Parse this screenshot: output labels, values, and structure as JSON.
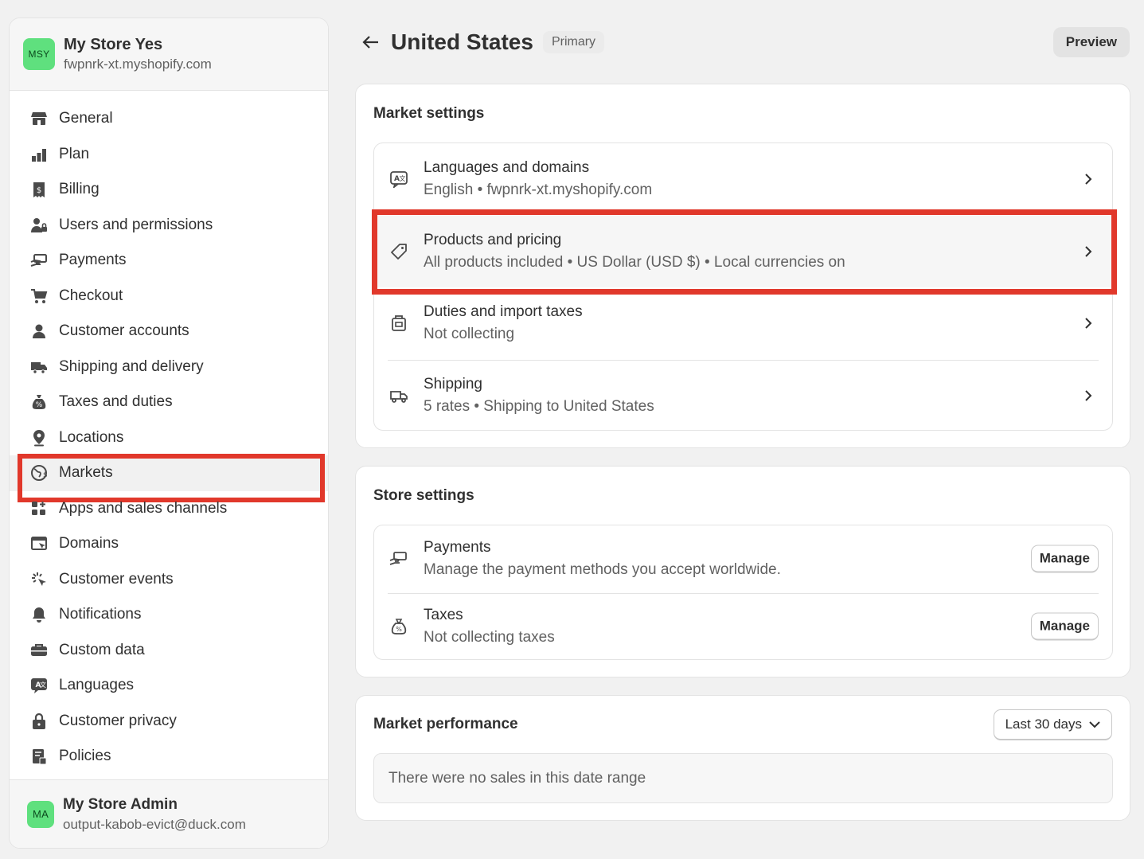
{
  "sidebar": {
    "store": {
      "initials": "MSY",
      "name": "My Store Yes",
      "url": "fwpnrk-xt.myshopify.com"
    },
    "items": [
      {
        "label": "General",
        "icon": "store-icon"
      },
      {
        "label": "Plan",
        "icon": "plan-icon"
      },
      {
        "label": "Billing",
        "icon": "billing-icon"
      },
      {
        "label": "Users and permissions",
        "icon": "users-icon"
      },
      {
        "label": "Payments",
        "icon": "payments-icon"
      },
      {
        "label": "Checkout",
        "icon": "cart-icon"
      },
      {
        "label": "Customer accounts",
        "icon": "person-icon"
      },
      {
        "label": "Shipping and delivery",
        "icon": "truck-icon"
      },
      {
        "label": "Taxes and duties",
        "icon": "tax-bag-icon"
      },
      {
        "label": "Locations",
        "icon": "location-pin-icon"
      },
      {
        "label": "Markets",
        "icon": "globe-icon",
        "active": true
      },
      {
        "label": "Apps and sales channels",
        "icon": "apps-icon"
      },
      {
        "label": "Domains",
        "icon": "domains-icon"
      },
      {
        "label": "Customer events",
        "icon": "cursor-icon"
      },
      {
        "label": "Notifications",
        "icon": "bell-icon"
      },
      {
        "label": "Custom data",
        "icon": "database-icon"
      },
      {
        "label": "Languages",
        "icon": "translate-icon"
      },
      {
        "label": "Customer privacy",
        "icon": "lock-icon"
      },
      {
        "label": "Policies",
        "icon": "policy-icon"
      }
    ],
    "user": {
      "initials": "MA",
      "name": "My Store Admin",
      "email": "output-kabob-evict@duck.com"
    }
  },
  "header": {
    "title": "United States",
    "badge": "Primary",
    "preview_label": "Preview"
  },
  "market_settings": {
    "title": "Market settings",
    "rows": [
      {
        "title": "Languages and domains",
        "subtitle": "English • fwpnrk-xt.myshopify.com",
        "icon": "translate-icon"
      },
      {
        "title": "Products and pricing",
        "subtitle": "All products included • US Dollar (USD $) • Local currencies on",
        "icon": "tag-icon"
      },
      {
        "title": "Duties and import taxes",
        "subtitle": "Not collecting",
        "icon": "duties-icon"
      },
      {
        "title": "Shipping",
        "subtitle": "5 rates • Shipping to United States",
        "icon": "truck-icon"
      }
    ]
  },
  "store_settings": {
    "title": "Store settings",
    "rows": [
      {
        "title": "Payments",
        "subtitle": "Manage the payment methods you accept worldwide.",
        "button": "Manage",
        "icon": "payments-icon"
      },
      {
        "title": "Taxes",
        "subtitle": "Not collecting taxes",
        "button": "Manage",
        "icon": "tax-bag-icon"
      }
    ]
  },
  "market_performance": {
    "title": "Market performance",
    "range_label": "Last 30 days",
    "empty_text": "There were no sales in this date range"
  }
}
